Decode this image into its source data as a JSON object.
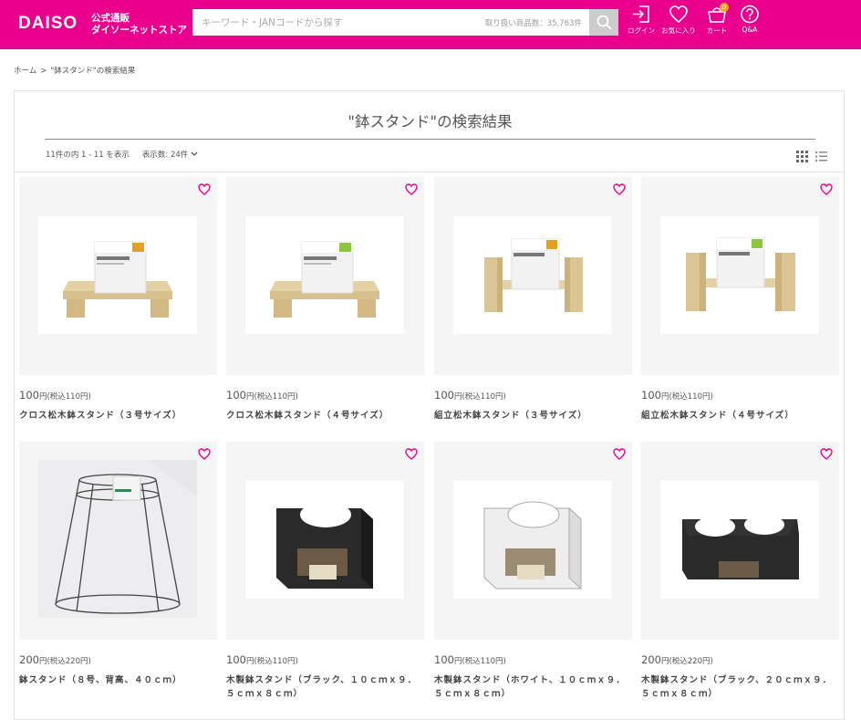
{
  "header": {
    "logo": "DAISO",
    "logo_sub_1": "公式通販",
    "logo_sub_2": "ダイソーネットストア",
    "search_placeholder": "キーワード・JANコードから探す",
    "search_count": "取り扱い商品数：35,763件",
    "nav": {
      "login": "ログイン",
      "favorites": "お気に入り",
      "cart": "カート",
      "cart_count": "0",
      "qa": "Q&A"
    },
    "brand_color": "#e9008c"
  },
  "breadcrumb": {
    "home": "ホーム",
    "separator": ">",
    "current": "\"鉢スタンド\"の検索結果"
  },
  "results": {
    "title": "\"鉢スタンド\"の検索結果",
    "count_text": "11件の内 1 - 11 を表示",
    "per_page": "表示数: 24件"
  },
  "products": [
    {
      "price": "100",
      "unit": "円(税込110円)",
      "name": "クロス松木鉢スタンド（３号サイズ）",
      "image": "wood-cross-stand-3"
    },
    {
      "price": "100",
      "unit": "円(税込110円)",
      "name": "クロス松木鉢スタンド（４号サイズ）",
      "image": "wood-cross-stand-4"
    },
    {
      "price": "100",
      "unit": "円(税込110円)",
      "name": "組立松木鉢スタンド（３号サイズ）",
      "image": "wood-assembly-stand-3"
    },
    {
      "price": "100",
      "unit": "円(税込110円)",
      "name": "組立松木鉢スタンド（４号サイズ）",
      "image": "wood-assembly-stand-4"
    },
    {
      "price": "200",
      "unit": "円(税込220円)",
      "name": "鉢スタンド（８号、背高、４０ｃｍ）",
      "image": "wire-stand"
    },
    {
      "price": "100",
      "unit": "円(税込110円)",
      "name": "木製鉢スタンド（ブラック、１０ｃｍｘ９．５ｃｍｘ８ｃｍ）",
      "image": "black-box-stand"
    },
    {
      "price": "100",
      "unit": "円(税込110円)",
      "name": "木製鉢スタンド（ホワイト、１０ｃｍｘ９．５ｃｍｘ８ｃｍ）",
      "image": "white-box-stand"
    },
    {
      "price": "200",
      "unit": "円(税込220円)",
      "name": "木製鉢スタンド（ブラック、２０ｃｍｘ９．５ｃｍｘ８ｃｍ）",
      "image": "black-double-stand"
    }
  ]
}
